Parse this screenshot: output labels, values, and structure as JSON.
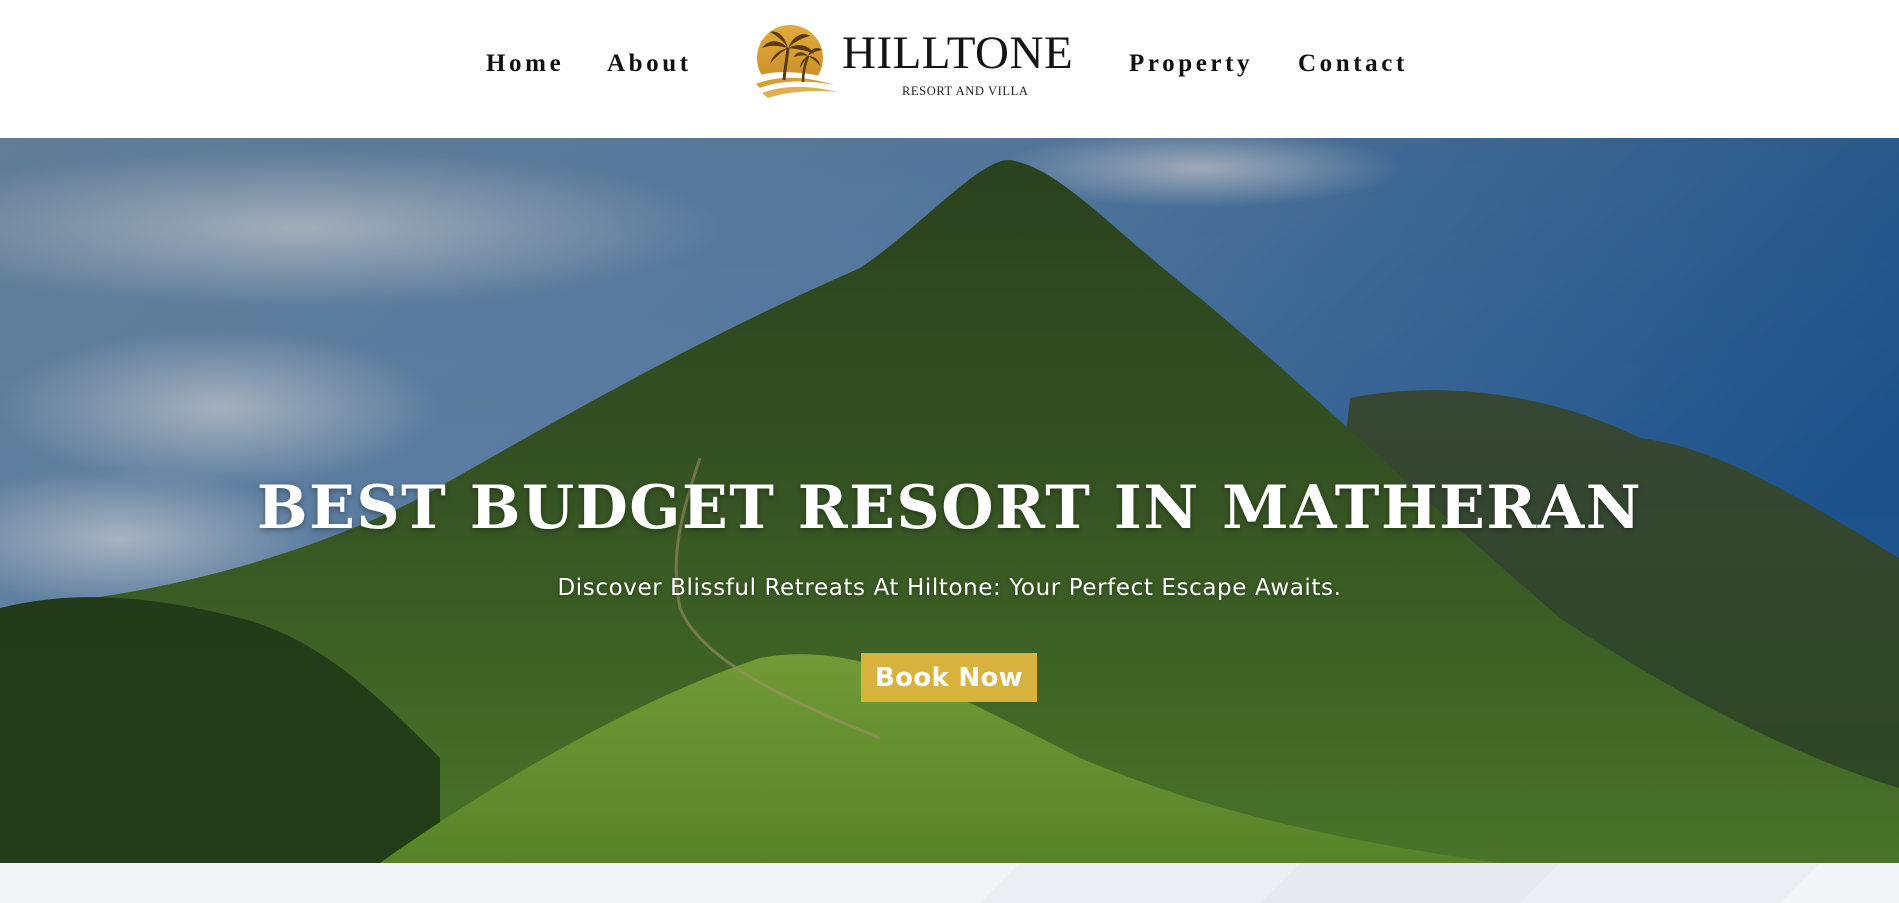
{
  "header": {
    "nav_left": [
      {
        "label": "Home"
      },
      {
        "label": "About"
      }
    ],
    "nav_right": [
      {
        "label": "Property"
      },
      {
        "label": "Contact"
      }
    ],
    "logo": {
      "name": "HILLTONE",
      "tagline": "RESORT AND VILLA",
      "icon": "palm-trees-sunset-icon"
    }
  },
  "hero": {
    "title": "BEST BUDGET RESORT IN MATHERAN",
    "subtitle": "Discover Blissful Retreats At Hiltone: Your Perfect Escape Awaits.",
    "cta_label": "Book Now",
    "background": "mountain-landscape-photo"
  },
  "colors": {
    "accent": "#d9b23e",
    "logo_gold": "#c9962e",
    "nav_text": "#111111",
    "hero_text": "#ffffff"
  }
}
